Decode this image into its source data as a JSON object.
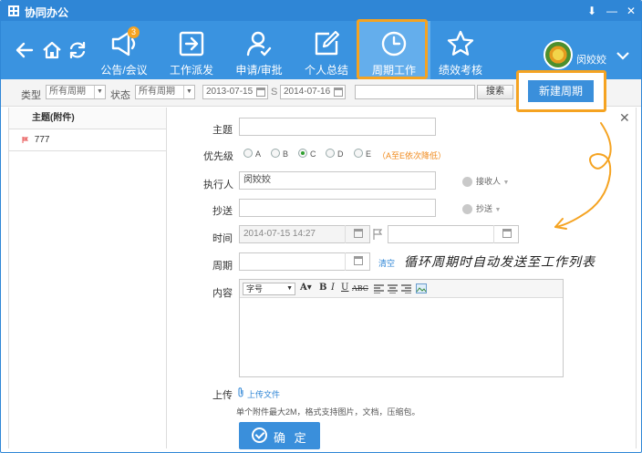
{
  "window": {
    "title": "协同办公"
  },
  "toolbar": {
    "tools": [
      {
        "label": "公告/会议",
        "badge": "3"
      },
      {
        "label": "工作派发"
      },
      {
        "label": "申请/审批"
      },
      {
        "label": "个人总结"
      },
      {
        "label": "周期工作"
      },
      {
        "label": "绩效考核"
      }
    ],
    "active_tool": "周期工作",
    "username": "闵姣姣"
  },
  "filter": {
    "type_label": "类型",
    "type_value": "所有周期",
    "status_label": "状态",
    "status_value": "所有周期",
    "date_from": "2013-07-15",
    "date_sep": "S",
    "date_to": "2014-07-16",
    "search_label": "搜索",
    "new_cycle_label": "新建周期"
  },
  "list": {
    "header": "主题(附件)",
    "items": [
      "777"
    ]
  },
  "form": {
    "subject_label": "主题",
    "priority_label": "优先级",
    "priority_options": [
      "A",
      "B",
      "C",
      "D",
      "E"
    ],
    "priority_selected": "C",
    "priority_note": "（A至E依次降低）",
    "assignee_label": "执行人",
    "assignee_value": "闵姣姣",
    "receiver_label": "接收人",
    "cc_label": "抄送",
    "cc_button_label": "抄送",
    "time_label": "时间",
    "time_value": "2014-07-15 14:27",
    "cycle_label": "周期",
    "clear_label": "清空",
    "content_label": "内容",
    "font_size_placeholder": "字号",
    "upload_label": "上传",
    "upload_link": "上传文件",
    "upload_note": "单个附件最大2M，格式支持图片，文档，压缩包。",
    "confirm_label": "确 定"
  },
  "annotation": "循环周期时自动发送至工作列表",
  "colors": {
    "brand": "#3a93e0",
    "titlebar": "#2f86d6",
    "highlight": "#f5a321",
    "primary_button": "#3a8fdb"
  }
}
